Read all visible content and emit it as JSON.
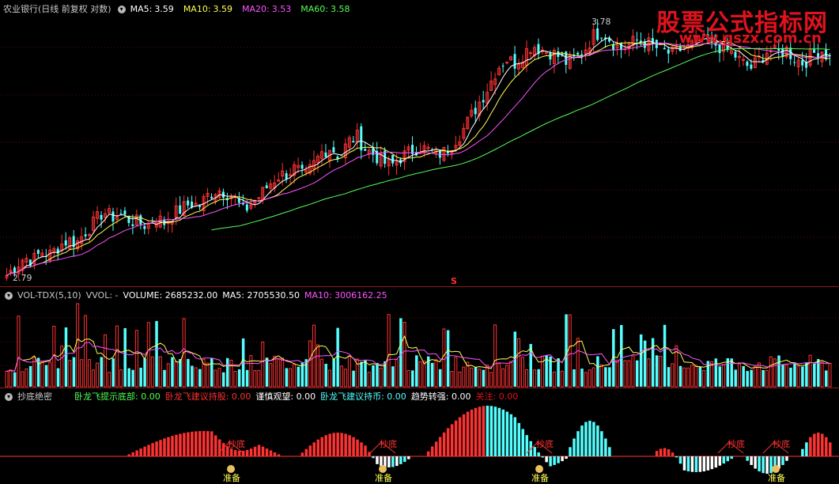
{
  "colors": {
    "up": "#ff3232",
    "down": "#54ffff",
    "ma5": "#ffffff",
    "ma10": "#ffff54",
    "ma20": "#ff54ff",
    "ma60": "#54ff54",
    "separator": "#8a1c1c"
  },
  "price_pane": {
    "title": "农业银行(日线 前复权 对数)",
    "ma5_label": "MA5:",
    "ma5_value": "3.59",
    "ma10_label": "MA10:",
    "ma10_value": "3.59",
    "ma20_label": "MA20:",
    "ma20_value": "3.53",
    "ma60_label": "MA60:",
    "ma60_value": "3.58",
    "high_label": "3.78",
    "low_label": "2.79",
    "marker": "S"
  },
  "watermark": {
    "title": "股票公式指标网",
    "url": "www.gszx.com.cn"
  },
  "volume_pane": {
    "title": "VOL-TDX(5,10)",
    "vvol": "VVOL: -",
    "volume": "VOLUME: 2685232.00",
    "ma5": "MA5: 2705530.50",
    "ma10": "MA10: 3006162.25"
  },
  "indicator_pane": {
    "title": "抄底绝密",
    "items": [
      {
        "text": "卧龙飞提示底部: 0.00",
        "color": "#54ff54"
      },
      {
        "text": "卧龙飞建议持股: 0.00",
        "color": "#ff3232"
      },
      {
        "text": "谨慎观望: 0.00",
        "color": "#ffffff"
      },
      {
        "text": "卧龙飞建议持币: 0.00",
        "color": "#54ffff"
      },
      {
        "text": "趋势转强: 0.00",
        "color": "#ffffff"
      },
      {
        "text": "关注: 0.00",
        "color": "#e0121d"
      }
    ],
    "signal_label": "抄底",
    "ready_label": "准备"
  },
  "chart_data": {
    "type": "candlestick",
    "scale": "log",
    "price_high": 3.78,
    "price_low": 2.79,
    "closes": [
      2.8,
      2.83,
      2.86,
      2.85,
      2.88,
      2.87,
      2.9,
      2.92,
      2.91,
      2.95,
      2.98,
      3.02,
      3.0,
      3.01,
      2.99,
      2.98,
      2.97,
      3.0,
      2.98,
      3.01,
      3.03,
      3.05,
      3.04,
      3.08,
      3.1,
      3.09,
      3.07,
      3.02,
      3.05,
      3.08,
      3.12,
      3.15,
      3.16,
      3.18,
      3.14,
      3.19,
      3.24,
      3.26,
      3.22,
      3.28,
      3.3,
      3.25,
      3.23,
      3.2,
      3.19,
      3.22,
      3.24,
      3.26,
      3.25,
      3.23,
      3.24,
      3.28,
      3.32,
      3.38,
      3.44,
      3.5,
      3.58,
      3.62,
      3.6,
      3.64,
      3.68,
      3.66,
      3.65,
      3.63,
      3.6,
      3.62,
      3.66,
      3.72,
      3.74,
      3.7,
      3.66,
      3.68,
      3.7,
      3.69,
      3.67,
      3.65,
      3.64,
      3.66,
      3.67,
      3.7,
      3.69,
      3.68,
      3.66,
      3.64,
      3.6,
      3.58,
      3.62,
      3.66,
      3.64,
      3.66,
      3.62,
      3.6,
      3.64,
      3.66,
      3.62
    ]
  }
}
